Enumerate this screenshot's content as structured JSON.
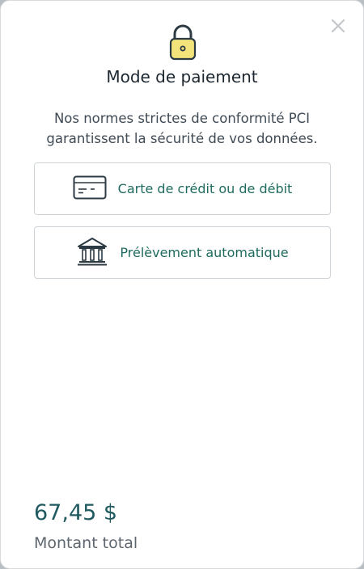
{
  "dialog": {
    "title": "Mode de paiement",
    "description": "Nos normes strictes de conformité PCI garantissent la sécurité de vos données.",
    "close_icon": "close-icon",
    "lock_icon": "lock-icon",
    "options": [
      {
        "label": "Carte de crédit ou de débit",
        "icon": "credit-card-icon"
      },
      {
        "label": "Prélèvement automatique",
        "icon": "bank-icon"
      }
    ]
  },
  "footer": {
    "amount": "67,45 $",
    "amount_label": "Montant total"
  },
  "colors": {
    "accent": "#1f6a5e",
    "lock_fill": "#f2e37a",
    "text_primary": "#1d2730"
  }
}
